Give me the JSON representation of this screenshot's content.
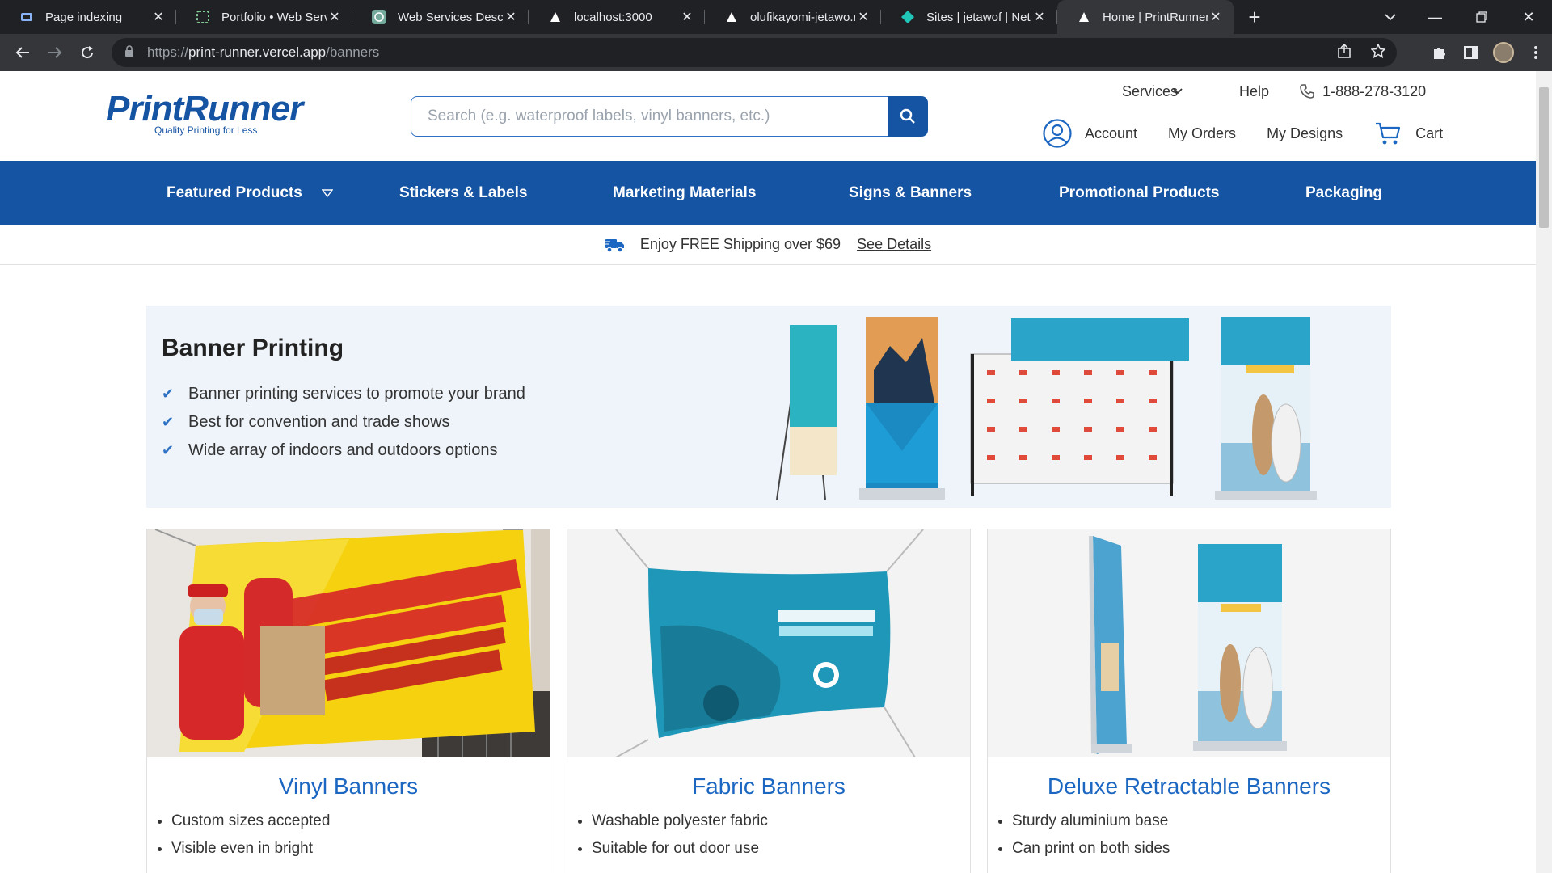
{
  "browser": {
    "tabs": [
      {
        "title": "Page indexing",
        "icon": "search-console-icon"
      },
      {
        "title": "Portfolio • Web Servic",
        "icon": "portfolio-icon"
      },
      {
        "title": "Web Services Descripti",
        "icon": "chatgpt-icon"
      },
      {
        "title": "localhost:3000",
        "icon": "vercel-triangle-icon"
      },
      {
        "title": "olufikayomi-jetawo.ne",
        "icon": "vercel-triangle-icon"
      },
      {
        "title": "Sites | jetawof | Netlify",
        "icon": "netlify-icon"
      },
      {
        "title": "Home | PrintRunner",
        "icon": "vercel-triangle-icon",
        "active": true
      }
    ],
    "url_host": "print-runner.vercel.app",
    "url_path": "/banners",
    "url_scheme": "https://"
  },
  "header": {
    "logo_word": "PrintRunner",
    "logo_tagline": "Quality Printing for Less",
    "search_placeholder": "Search (e.g. waterproof labels, vinyl banners, etc.)",
    "services": "Services",
    "help": "Help",
    "phone": "1-888-278-3120",
    "account": "Account",
    "orders": "My Orders",
    "designs": "My Designs",
    "cart": "Cart"
  },
  "nav": {
    "featured": "Featured Products",
    "stickers": "Stickers & Labels",
    "marketing": "Marketing Materials",
    "signs": "Signs & Banners",
    "promo": "Promotional Products",
    "packaging": "Packaging"
  },
  "shipping": {
    "text": "Enjoy FREE Shipping over $69",
    "link": "See Details"
  },
  "hero": {
    "title": "Banner Printing",
    "bullets": [
      "Banner printing services to promote your brand",
      "Best for convention and trade shows",
      "Wide array of indoors and outdoors options"
    ]
  },
  "cards": [
    {
      "title": "Vinyl Banners",
      "bullets": [
        "Custom sizes accepted",
        "Visible even in bright"
      ]
    },
    {
      "title": "Fabric Banners",
      "bullets": [
        "Washable polyester fabric",
        "Suitable for out door use"
      ]
    },
    {
      "title": "Deluxe Retractable Banners",
      "bullets": [
        "Sturdy aluminium base",
        "Can print on both sides"
      ]
    }
  ],
  "colors": {
    "brand_blue": "#1553a3",
    "link_blue": "#1c67c2",
    "hero_bg": "#eef4fa"
  }
}
